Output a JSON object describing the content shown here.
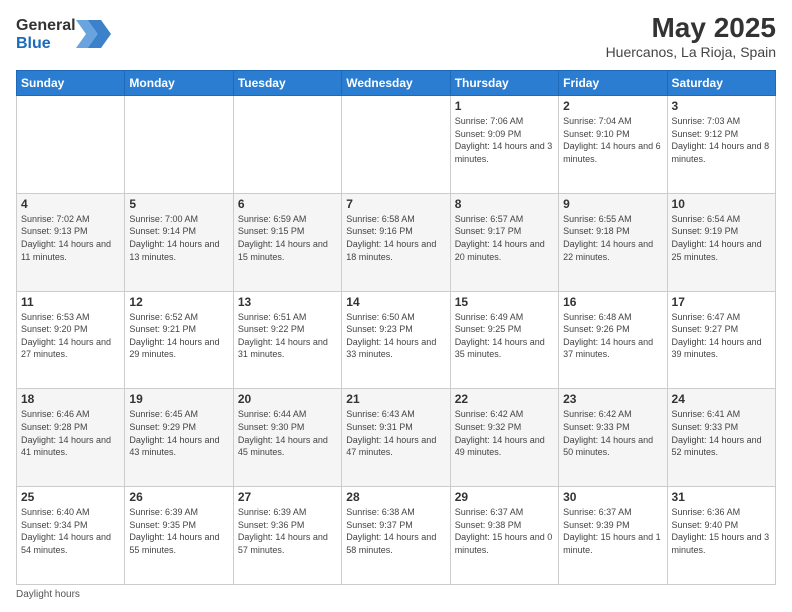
{
  "header": {
    "logo_line1": "General",
    "logo_line2": "Blue",
    "month": "May 2025",
    "location": "Huercanos, La Rioja, Spain"
  },
  "days_of_week": [
    "Sunday",
    "Monday",
    "Tuesday",
    "Wednesday",
    "Thursday",
    "Friday",
    "Saturday"
  ],
  "weeks": [
    [
      {
        "day": "",
        "sunrise": "",
        "sunset": "",
        "daylight": ""
      },
      {
        "day": "",
        "sunrise": "",
        "sunset": "",
        "daylight": ""
      },
      {
        "day": "",
        "sunrise": "",
        "sunset": "",
        "daylight": ""
      },
      {
        "day": "",
        "sunrise": "",
        "sunset": "",
        "daylight": ""
      },
      {
        "day": "1",
        "sunrise": "Sunrise: 7:06 AM",
        "sunset": "Sunset: 9:09 PM",
        "daylight": "Daylight: 14 hours and 3 minutes."
      },
      {
        "day": "2",
        "sunrise": "Sunrise: 7:04 AM",
        "sunset": "Sunset: 9:10 PM",
        "daylight": "Daylight: 14 hours and 6 minutes."
      },
      {
        "day": "3",
        "sunrise": "Sunrise: 7:03 AM",
        "sunset": "Sunset: 9:12 PM",
        "daylight": "Daylight: 14 hours and 8 minutes."
      }
    ],
    [
      {
        "day": "4",
        "sunrise": "Sunrise: 7:02 AM",
        "sunset": "Sunset: 9:13 PM",
        "daylight": "Daylight: 14 hours and 11 minutes."
      },
      {
        "day": "5",
        "sunrise": "Sunrise: 7:00 AM",
        "sunset": "Sunset: 9:14 PM",
        "daylight": "Daylight: 14 hours and 13 minutes."
      },
      {
        "day": "6",
        "sunrise": "Sunrise: 6:59 AM",
        "sunset": "Sunset: 9:15 PM",
        "daylight": "Daylight: 14 hours and 15 minutes."
      },
      {
        "day": "7",
        "sunrise": "Sunrise: 6:58 AM",
        "sunset": "Sunset: 9:16 PM",
        "daylight": "Daylight: 14 hours and 18 minutes."
      },
      {
        "day": "8",
        "sunrise": "Sunrise: 6:57 AM",
        "sunset": "Sunset: 9:17 PM",
        "daylight": "Daylight: 14 hours and 20 minutes."
      },
      {
        "day": "9",
        "sunrise": "Sunrise: 6:55 AM",
        "sunset": "Sunset: 9:18 PM",
        "daylight": "Daylight: 14 hours and 22 minutes."
      },
      {
        "day": "10",
        "sunrise": "Sunrise: 6:54 AM",
        "sunset": "Sunset: 9:19 PM",
        "daylight": "Daylight: 14 hours and 25 minutes."
      }
    ],
    [
      {
        "day": "11",
        "sunrise": "Sunrise: 6:53 AM",
        "sunset": "Sunset: 9:20 PM",
        "daylight": "Daylight: 14 hours and 27 minutes."
      },
      {
        "day": "12",
        "sunrise": "Sunrise: 6:52 AM",
        "sunset": "Sunset: 9:21 PM",
        "daylight": "Daylight: 14 hours and 29 minutes."
      },
      {
        "day": "13",
        "sunrise": "Sunrise: 6:51 AM",
        "sunset": "Sunset: 9:22 PM",
        "daylight": "Daylight: 14 hours and 31 minutes."
      },
      {
        "day": "14",
        "sunrise": "Sunrise: 6:50 AM",
        "sunset": "Sunset: 9:23 PM",
        "daylight": "Daylight: 14 hours and 33 minutes."
      },
      {
        "day": "15",
        "sunrise": "Sunrise: 6:49 AM",
        "sunset": "Sunset: 9:25 PM",
        "daylight": "Daylight: 14 hours and 35 minutes."
      },
      {
        "day": "16",
        "sunrise": "Sunrise: 6:48 AM",
        "sunset": "Sunset: 9:26 PM",
        "daylight": "Daylight: 14 hours and 37 minutes."
      },
      {
        "day": "17",
        "sunrise": "Sunrise: 6:47 AM",
        "sunset": "Sunset: 9:27 PM",
        "daylight": "Daylight: 14 hours and 39 minutes."
      }
    ],
    [
      {
        "day": "18",
        "sunrise": "Sunrise: 6:46 AM",
        "sunset": "Sunset: 9:28 PM",
        "daylight": "Daylight: 14 hours and 41 minutes."
      },
      {
        "day": "19",
        "sunrise": "Sunrise: 6:45 AM",
        "sunset": "Sunset: 9:29 PM",
        "daylight": "Daylight: 14 hours and 43 minutes."
      },
      {
        "day": "20",
        "sunrise": "Sunrise: 6:44 AM",
        "sunset": "Sunset: 9:30 PM",
        "daylight": "Daylight: 14 hours and 45 minutes."
      },
      {
        "day": "21",
        "sunrise": "Sunrise: 6:43 AM",
        "sunset": "Sunset: 9:31 PM",
        "daylight": "Daylight: 14 hours and 47 minutes."
      },
      {
        "day": "22",
        "sunrise": "Sunrise: 6:42 AM",
        "sunset": "Sunset: 9:32 PM",
        "daylight": "Daylight: 14 hours and 49 minutes."
      },
      {
        "day": "23",
        "sunrise": "Sunrise: 6:42 AM",
        "sunset": "Sunset: 9:33 PM",
        "daylight": "Daylight: 14 hours and 50 minutes."
      },
      {
        "day": "24",
        "sunrise": "Sunrise: 6:41 AM",
        "sunset": "Sunset: 9:33 PM",
        "daylight": "Daylight: 14 hours and 52 minutes."
      }
    ],
    [
      {
        "day": "25",
        "sunrise": "Sunrise: 6:40 AM",
        "sunset": "Sunset: 9:34 PM",
        "daylight": "Daylight: 14 hours and 54 minutes."
      },
      {
        "day": "26",
        "sunrise": "Sunrise: 6:39 AM",
        "sunset": "Sunset: 9:35 PM",
        "daylight": "Daylight: 14 hours and 55 minutes."
      },
      {
        "day": "27",
        "sunrise": "Sunrise: 6:39 AM",
        "sunset": "Sunset: 9:36 PM",
        "daylight": "Daylight: 14 hours and 57 minutes."
      },
      {
        "day": "28",
        "sunrise": "Sunrise: 6:38 AM",
        "sunset": "Sunset: 9:37 PM",
        "daylight": "Daylight: 14 hours and 58 minutes."
      },
      {
        "day": "29",
        "sunrise": "Sunrise: 6:37 AM",
        "sunset": "Sunset: 9:38 PM",
        "daylight": "Daylight: 15 hours and 0 minutes."
      },
      {
        "day": "30",
        "sunrise": "Sunrise: 6:37 AM",
        "sunset": "Sunset: 9:39 PM",
        "daylight": "Daylight: 15 hours and 1 minute."
      },
      {
        "day": "31",
        "sunrise": "Sunrise: 6:36 AM",
        "sunset": "Sunset: 9:40 PM",
        "daylight": "Daylight: 15 hours and 3 minutes."
      }
    ]
  ],
  "footer": {
    "note": "Daylight hours"
  },
  "colors": {
    "header_bg": "#2a7dd1",
    "header_text": "#ffffff",
    "odd_row": "#ffffff",
    "even_row": "#f5f5f5"
  }
}
